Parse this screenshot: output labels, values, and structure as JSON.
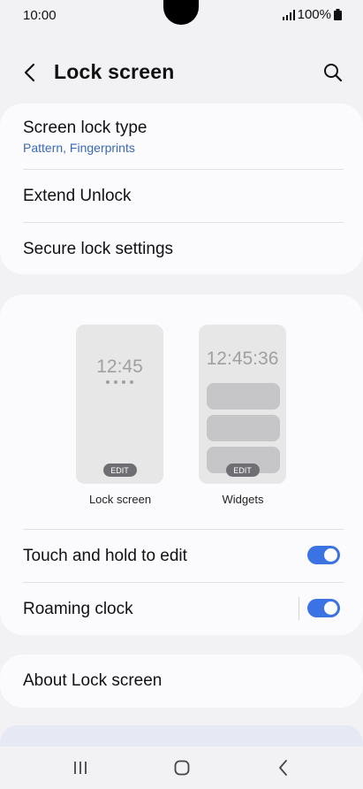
{
  "status_bar": {
    "time": "10:00",
    "battery": "100%"
  },
  "header": {
    "title": "Lock screen"
  },
  "security": {
    "screen_lock_type": {
      "label": "Screen lock type",
      "value": "Pattern, Fingerprints"
    },
    "extend_unlock": "Extend Unlock",
    "secure_lock_settings": "Secure lock settings"
  },
  "previews": {
    "lock": {
      "clock": "12:45",
      "edit": "EDIT",
      "label": "Lock screen"
    },
    "widgets": {
      "clock": "12:45:36",
      "edit": "EDIT",
      "label": "Widgets"
    }
  },
  "toggles": {
    "touch_hold": {
      "label": "Touch and hold to edit",
      "on": true
    },
    "roaming_clock": {
      "label": "Roaming clock",
      "on": true
    }
  },
  "about": {
    "label": "About Lock screen"
  },
  "colors": {
    "accent": "#3b73e5",
    "subtext": "#3a6ab7",
    "background": "#f2f2f4",
    "card": "#fbfbfd"
  },
  "icons": [
    "signal-icon",
    "battery-icon",
    "back-arrow-icon",
    "search-icon",
    "recents-icon",
    "home-icon",
    "nav-back-icon"
  ]
}
